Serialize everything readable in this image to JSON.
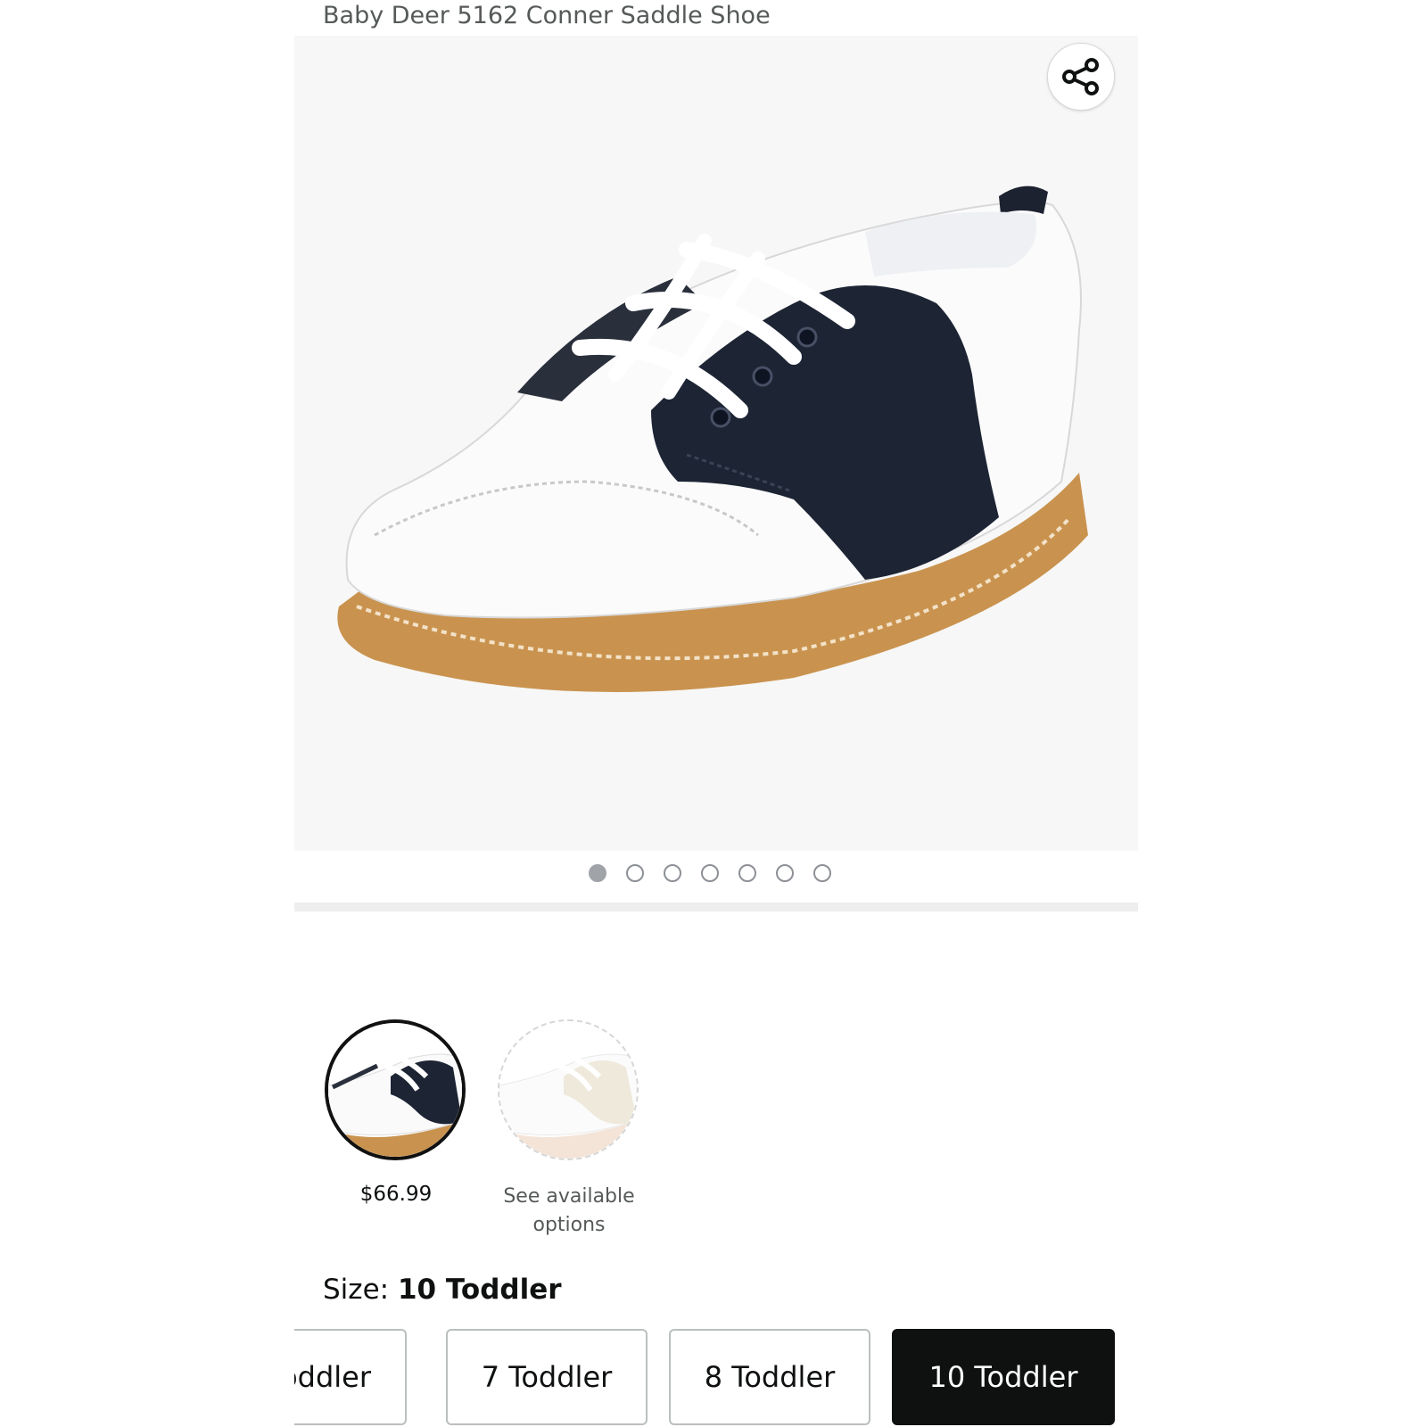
{
  "product": {
    "title": "Baby Deer 5162 Conner Saddle Shoe"
  },
  "gallery": {
    "total_images": 7,
    "active_index": 0
  },
  "colors": {
    "accent": "#0f1111",
    "muted_text": "#565959",
    "selected_swatch_border": "#111111"
  },
  "style_options": [
    {
      "price": "$66.99",
      "selected": true
    },
    {
      "note": "See available options",
      "selected": false
    }
  ],
  "size_selector": {
    "label": "Size:",
    "selected_value": "10 Toddler",
    "options": [
      "Toddler",
      "7 Toddler",
      "8 Toddler",
      "10 Toddler"
    ]
  },
  "icons": {
    "share": "share-icon"
  }
}
